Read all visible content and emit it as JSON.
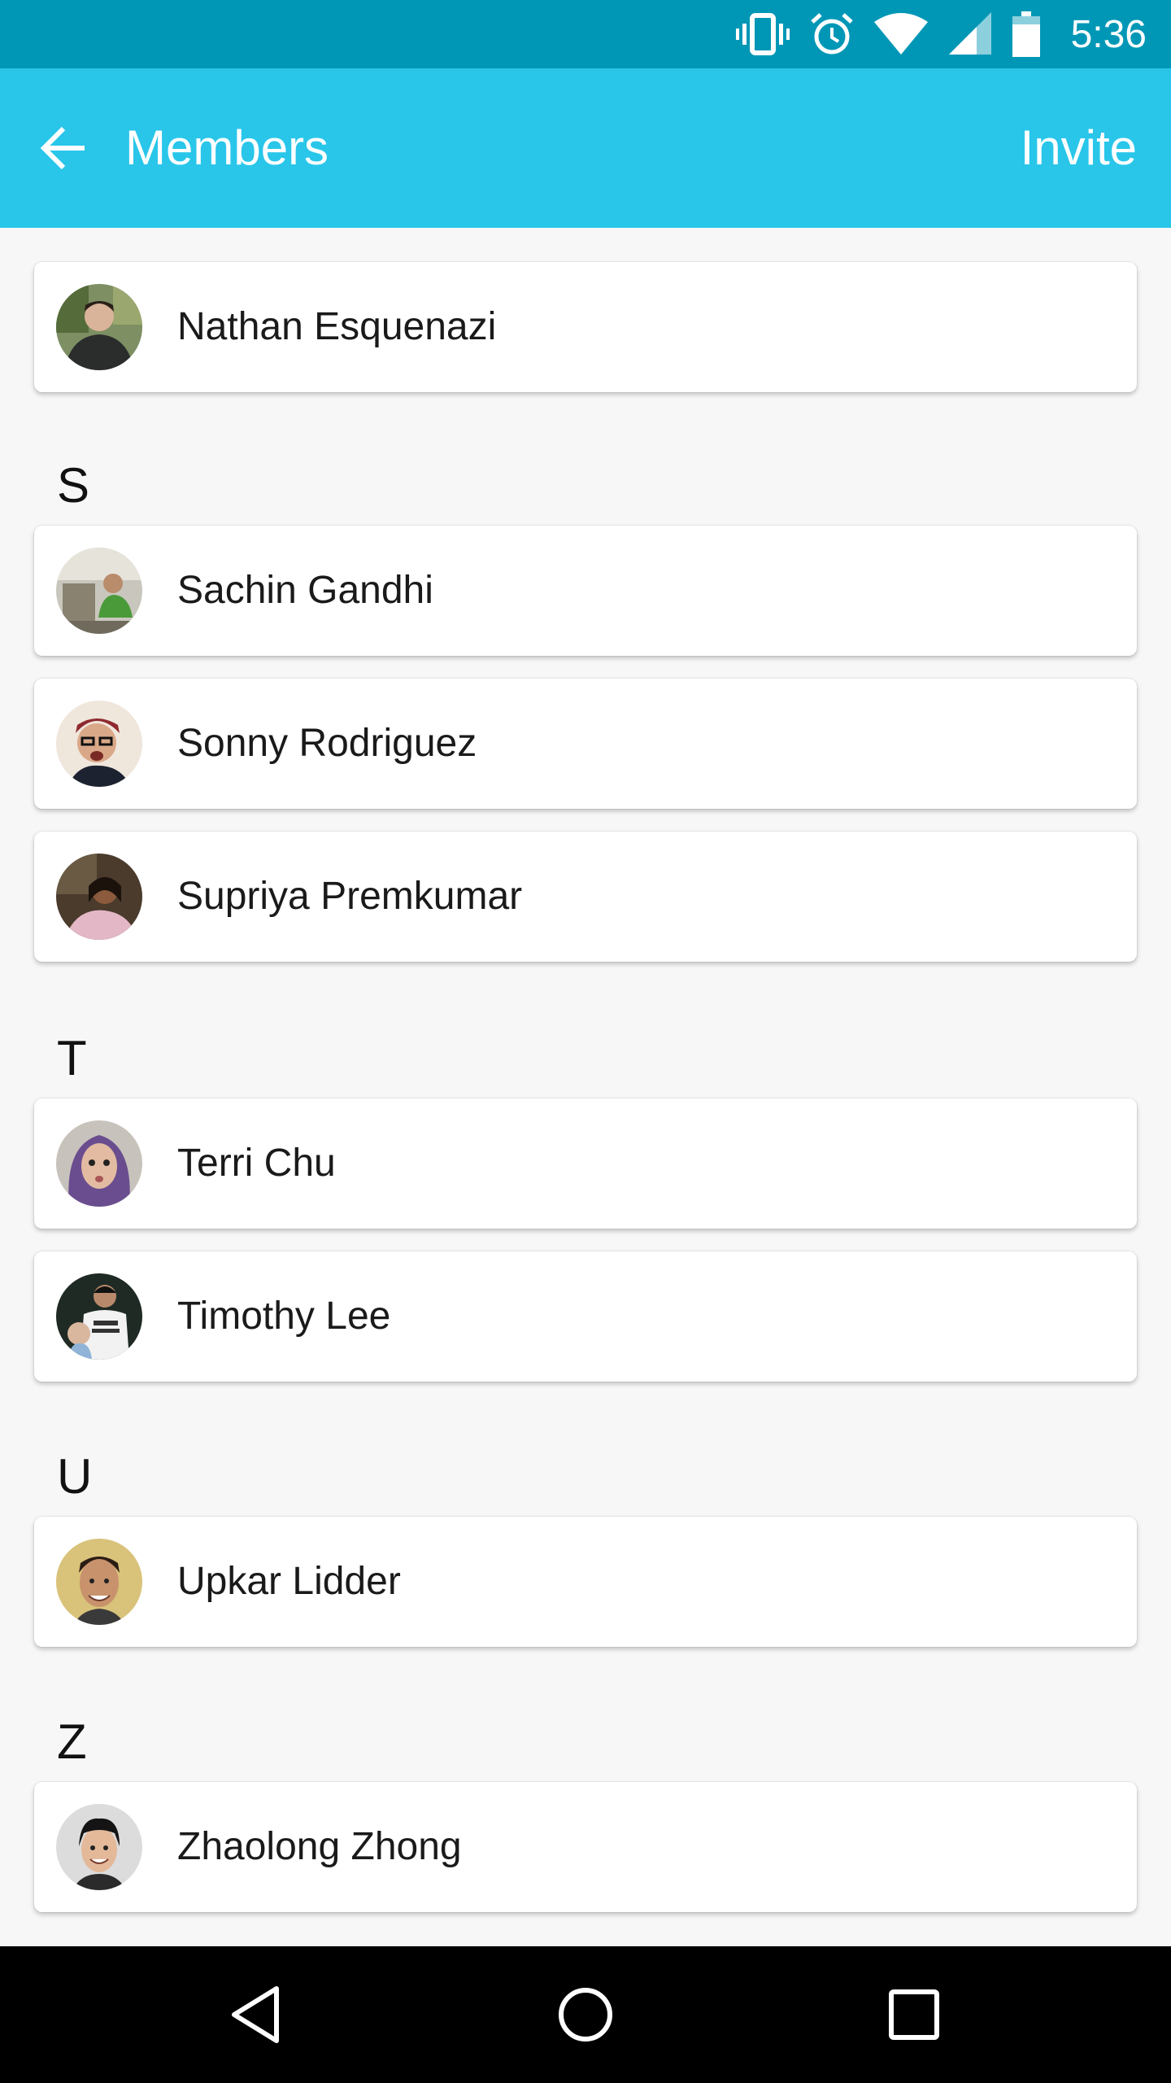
{
  "status_bar": {
    "time": "5:36",
    "icons": [
      "vibrate-icon",
      "alarm-icon",
      "wifi-icon",
      "signal-icon",
      "battery-icon"
    ]
  },
  "app_bar": {
    "title": "Members",
    "action_label": "Invite",
    "back_icon": "arrow-back-icon",
    "background_color": "#29c6ea",
    "status_color": "#0097b6"
  },
  "sections": [
    {
      "letter": "",
      "members": [
        "Nathan Esquenazi"
      ]
    },
    {
      "letter": "S",
      "members": [
        "Sachin Gandhi",
        "Sonny Rodriguez",
        "Supriya Premkumar"
      ]
    },
    {
      "letter": "T",
      "members": [
        "Terri Chu",
        "Timothy Lee"
      ]
    },
    {
      "letter": "U",
      "members": [
        "Upkar Lidder"
      ]
    },
    {
      "letter": "Z",
      "members": [
        "Zhaolong Zhong"
      ]
    }
  ],
  "nav_bar": {
    "icons": [
      "nav-back-icon",
      "nav-home-icon",
      "nav-recents-icon"
    ]
  }
}
